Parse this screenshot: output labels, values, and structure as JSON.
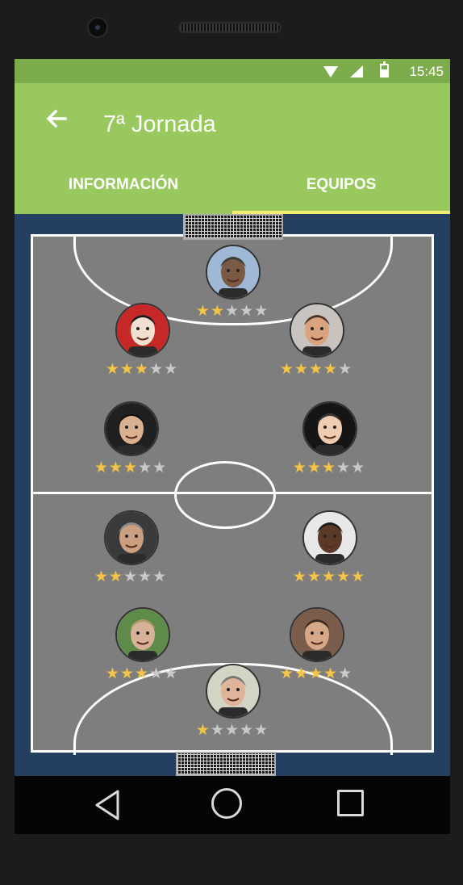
{
  "status_bar": {
    "time": "15:45",
    "icons": [
      "wifi-icon",
      "signal-icon",
      "battery-icon"
    ]
  },
  "app_bar": {
    "title": "7ª Jornada",
    "back_icon": "arrow-back-icon",
    "tabs": [
      {
        "label": "INFORMACIÓN",
        "selected": false
      },
      {
        "label": "EQUIPOS",
        "selected": true
      }
    ]
  },
  "colors": {
    "status_bar": "#7cac4b",
    "app_bar": "#99c95e",
    "tab_indicator": "#f4ed73",
    "field_bg": "#253f60",
    "pitch": "#7e7e7e",
    "star_on": "#f3c34a",
    "star_off": "#c9c9c9"
  },
  "players": [
    {
      "id": "gk-top",
      "rating": 2,
      "max": 5,
      "avatar": "bald-smiling-man",
      "skin": "#7a5a44",
      "hair": "#3a3a3a",
      "bg": "#9fb8d6"
    },
    {
      "id": "top-left",
      "rating": 3,
      "max": 5,
      "avatar": "cartoon-bearded-man",
      "skin": "#f0e0d0",
      "hair": "#1a1a1a",
      "bg": "#c62828"
    },
    {
      "id": "top-right",
      "rating": 4,
      "max": 5,
      "avatar": "man-sunglasses",
      "skin": "#d9a380",
      "hair": "#4a3426",
      "bg": "#c8c3be"
    },
    {
      "id": "mid-left",
      "rating": 3,
      "max": 5,
      "avatar": "man-glasses",
      "skin": "#d9b090",
      "hair": "#111111",
      "bg": "#202020"
    },
    {
      "id": "mid-right",
      "rating": 3,
      "max": 5,
      "avatar": "man-hat",
      "skin": "#f0ccb0",
      "hair": "#333333",
      "bg": "#151515"
    },
    {
      "id": "low-left",
      "rating": 2,
      "max": 5,
      "avatar": "older-man-hand-head",
      "skin": "#caa080",
      "hair": "#8a8a8a",
      "bg": "#3a3a3a"
    },
    {
      "id": "low-right",
      "rating": 5,
      "max": 5,
      "avatar": "smiling-man-suit",
      "skin": "#5a3a26",
      "hair": "#1a1a1a",
      "bg": "#e8e8e8"
    },
    {
      "id": "back-left",
      "rating": 3,
      "max": 5,
      "avatar": "blond-man",
      "skin": "#d8b298",
      "hair": "#b09a6a",
      "bg": "#5f8b4a"
    },
    {
      "id": "back-right",
      "rating": 4,
      "max": 5,
      "avatar": "bearded-man",
      "skin": "#d6a888",
      "hair": "#3b2a1e",
      "bg": "#7a5c4a"
    },
    {
      "id": "gk-bottom",
      "rating": 1,
      "max": 5,
      "avatar": "smiling-man-gray-hair",
      "skin": "#e0b49a",
      "hair": "#777777",
      "bg": "#d4d4c4"
    }
  ],
  "nav_bar": {
    "icons": [
      "back-triangle-icon",
      "home-circle-icon",
      "recents-square-icon"
    ]
  }
}
